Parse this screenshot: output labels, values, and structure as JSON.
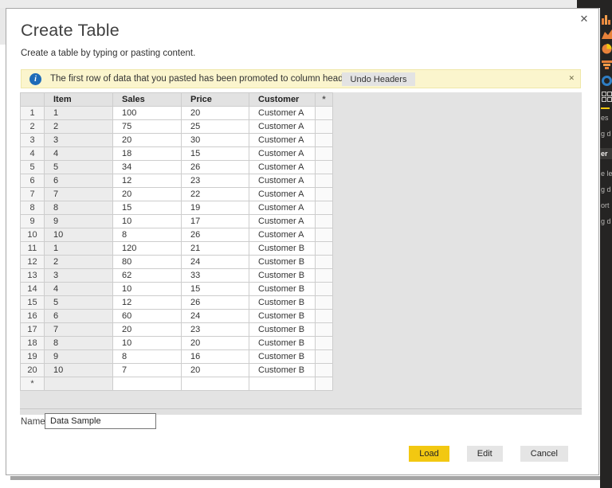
{
  "colors": {
    "accent_yellow": "#F2C811",
    "info_blue": "#1E6BB8",
    "banner_bg": "#FBF5CD",
    "dark_pane": "#252423"
  },
  "dialog": {
    "title": "Create Table",
    "subtitle": "Create a table by typing or pasting content.",
    "close_label": "✕",
    "banner": {
      "icon": "info-icon",
      "icon_glyph": "i",
      "message": "The first row of data that you pasted has been promoted to column headers.",
      "undo_button_label": "Undo Headers",
      "close_label": "✕"
    },
    "table": {
      "headers": [
        "",
        "Item",
        "Sales",
        "Price",
        "Customer",
        "*"
      ],
      "rows": [
        [
          "1",
          "1",
          "100",
          "20",
          "Customer A",
          ""
        ],
        [
          "2",
          "2",
          "75",
          "25",
          "Customer A",
          ""
        ],
        [
          "3",
          "3",
          "20",
          "30",
          "Customer A",
          ""
        ],
        [
          "4",
          "4",
          "18",
          "15",
          "Customer A",
          ""
        ],
        [
          "5",
          "5",
          "34",
          "26",
          "Customer A",
          ""
        ],
        [
          "6",
          "6",
          "12",
          "23",
          "Customer A",
          ""
        ],
        [
          "7",
          "7",
          "20",
          "22",
          "Customer A",
          ""
        ],
        [
          "8",
          "8",
          "15",
          "19",
          "Customer A",
          ""
        ],
        [
          "9",
          "9",
          "10",
          "17",
          "Customer A",
          ""
        ],
        [
          "10",
          "10",
          "8",
          "26",
          "Customer A",
          ""
        ],
        [
          "11",
          "1",
          "120",
          "21",
          "Customer B",
          ""
        ],
        [
          "12",
          "2",
          "80",
          "24",
          "Customer B",
          ""
        ],
        [
          "13",
          "3",
          "62",
          "33",
          "Customer B",
          ""
        ],
        [
          "14",
          "4",
          "10",
          "15",
          "Customer B",
          ""
        ],
        [
          "15",
          "5",
          "12",
          "26",
          "Customer B",
          ""
        ],
        [
          "16",
          "6",
          "60",
          "24",
          "Customer B",
          ""
        ],
        [
          "17",
          "7",
          "20",
          "23",
          "Customer B",
          ""
        ],
        [
          "18",
          "8",
          "10",
          "20",
          "Customer B",
          ""
        ],
        [
          "19",
          "9",
          "8",
          "16",
          "Customer B",
          ""
        ],
        [
          "20",
          "10",
          "7",
          "20",
          "Customer B",
          ""
        ],
        [
          "*",
          "",
          "",
          "",
          "",
          ""
        ]
      ]
    },
    "name_field": {
      "label": "Name:",
      "value": "Data Sample"
    },
    "buttons": {
      "load": "Load",
      "edit": "Edit",
      "cancel": "Cancel"
    }
  },
  "background_app": {
    "right_pane": {
      "icons": [
        "bar-chart-icon",
        "area-chart-icon",
        "pie-chart-icon",
        "funnel-icon",
        "donut-chart-icon",
        "matrix-icon"
      ],
      "fragments": [
        "es",
        "g d",
        "er",
        "e le",
        "g d",
        "ort",
        "g d"
      ]
    }
  }
}
